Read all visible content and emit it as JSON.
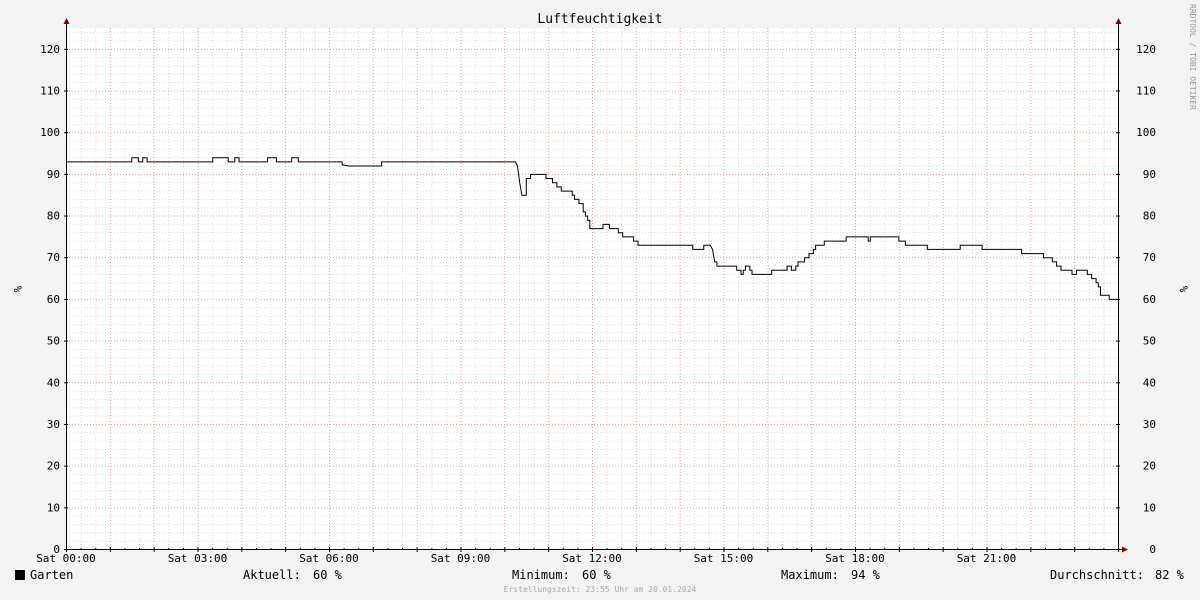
{
  "chart_data": {
    "type": "line",
    "title": "Luftfeuchtigkeit",
    "ylabel": "%",
    "ylabel_right": "%",
    "ylim": [
      0,
      125
    ],
    "yticks": [
      0,
      10,
      20,
      30,
      40,
      50,
      60,
      70,
      80,
      90,
      100,
      110,
      120
    ],
    "x_range_hours": [
      0,
      24
    ],
    "xticks": [
      {
        "hour": 0,
        "label": "Sat 00:00"
      },
      {
        "hour": 3,
        "label": "Sat 03:00"
      },
      {
        "hour": 6,
        "label": "Sat 06:00"
      },
      {
        "hour": 9,
        "label": "Sat 09:00"
      },
      {
        "hour": 12,
        "label": "Sat 12:00"
      },
      {
        "hour": 15,
        "label": "Sat 15:00"
      },
      {
        "hour": 18,
        "label": "Sat 18:00"
      },
      {
        "hour": 21,
        "label": "Sat 21:00"
      }
    ],
    "grid": true,
    "watermark": "RRDTOOL / TOBI OETIKER",
    "series": [
      {
        "name": "Garten",
        "color": "#000000",
        "points": [
          [
            0.0,
            93
          ],
          [
            1.5,
            93
          ],
          [
            1.5,
            94
          ],
          [
            1.65,
            94
          ],
          [
            1.65,
            93
          ],
          [
            1.75,
            93
          ],
          [
            1.75,
            94
          ],
          [
            1.85,
            94
          ],
          [
            1.85,
            93
          ],
          [
            3.35,
            93
          ],
          [
            3.35,
            94
          ],
          [
            3.7,
            94
          ],
          [
            3.7,
            93
          ],
          [
            3.85,
            93
          ],
          [
            3.85,
            94
          ],
          [
            3.95,
            94
          ],
          [
            3.95,
            93
          ],
          [
            4.6,
            93
          ],
          [
            4.6,
            94
          ],
          [
            4.8,
            94
          ],
          [
            4.8,
            93
          ],
          [
            5.15,
            93
          ],
          [
            5.15,
            94
          ],
          [
            5.3,
            94
          ],
          [
            5.3,
            93
          ],
          [
            6.3,
            93
          ],
          [
            6.3,
            92.3
          ],
          [
            6.45,
            92
          ],
          [
            7.2,
            92
          ],
          [
            7.2,
            93
          ],
          [
            10.25,
            93
          ],
          [
            10.3,
            92
          ],
          [
            10.35,
            88
          ],
          [
            10.4,
            85
          ],
          [
            10.5,
            85
          ],
          [
            10.5,
            89
          ],
          [
            10.6,
            89
          ],
          [
            10.6,
            90
          ],
          [
            10.95,
            90
          ],
          [
            10.95,
            89
          ],
          [
            11.1,
            89
          ],
          [
            11.1,
            88
          ],
          [
            11.2,
            88
          ],
          [
            11.2,
            87
          ],
          [
            11.3,
            87
          ],
          [
            11.3,
            86
          ],
          [
            11.55,
            86
          ],
          [
            11.55,
            85
          ],
          [
            11.6,
            85
          ],
          [
            11.6,
            84
          ],
          [
            11.7,
            84
          ],
          [
            11.7,
            83
          ],
          [
            11.8,
            83
          ],
          [
            11.8,
            81
          ],
          [
            11.85,
            81
          ],
          [
            11.85,
            80
          ],
          [
            11.9,
            80
          ],
          [
            11.9,
            79
          ],
          [
            11.95,
            79
          ],
          [
            11.95,
            77
          ],
          [
            12.25,
            77
          ],
          [
            12.25,
            78
          ],
          [
            12.4,
            78
          ],
          [
            12.4,
            77
          ],
          [
            12.6,
            77
          ],
          [
            12.6,
            76
          ],
          [
            12.7,
            76
          ],
          [
            12.7,
            75
          ],
          [
            12.95,
            75
          ],
          [
            12.95,
            74
          ],
          [
            13.05,
            74
          ],
          [
            13.05,
            73
          ],
          [
            14.3,
            73
          ],
          [
            14.3,
            72
          ],
          [
            14.55,
            72
          ],
          [
            14.55,
            73
          ],
          [
            14.7,
            73
          ],
          [
            14.75,
            72
          ],
          [
            14.8,
            69
          ],
          [
            14.85,
            69
          ],
          [
            14.85,
            68
          ],
          [
            15.3,
            68
          ],
          [
            15.3,
            67
          ],
          [
            15.4,
            67
          ],
          [
            15.4,
            66
          ],
          [
            15.45,
            66
          ],
          [
            15.45,
            67
          ],
          [
            15.5,
            67
          ],
          [
            15.5,
            68
          ],
          [
            15.6,
            68
          ],
          [
            15.6,
            67
          ],
          [
            15.65,
            67
          ],
          [
            15.65,
            66
          ],
          [
            16.1,
            66
          ],
          [
            16.1,
            67
          ],
          [
            16.45,
            67
          ],
          [
            16.45,
            68
          ],
          [
            16.55,
            68
          ],
          [
            16.55,
            67
          ],
          [
            16.65,
            67
          ],
          [
            16.65,
            68
          ],
          [
            16.7,
            68
          ],
          [
            16.7,
            69
          ],
          [
            16.85,
            69
          ],
          [
            16.85,
            70
          ],
          [
            16.95,
            70
          ],
          [
            16.95,
            71
          ],
          [
            17.05,
            71
          ],
          [
            17.05,
            72
          ],
          [
            17.1,
            72
          ],
          [
            17.1,
            73
          ],
          [
            17.3,
            73
          ],
          [
            17.3,
            74
          ],
          [
            17.8,
            74
          ],
          [
            17.8,
            75
          ],
          [
            18.3,
            75
          ],
          [
            18.3,
            74
          ],
          [
            18.35,
            74
          ],
          [
            18.35,
            75
          ],
          [
            19.0,
            75
          ],
          [
            19.0,
            74
          ],
          [
            19.15,
            74
          ],
          [
            19.15,
            73
          ],
          [
            19.65,
            73
          ],
          [
            19.65,
            72
          ],
          [
            20.4,
            72
          ],
          [
            20.4,
            73
          ],
          [
            20.9,
            73
          ],
          [
            20.9,
            72
          ],
          [
            21.8,
            72
          ],
          [
            21.8,
            71
          ],
          [
            22.3,
            71
          ],
          [
            22.3,
            70
          ],
          [
            22.5,
            70
          ],
          [
            22.5,
            69
          ],
          [
            22.6,
            69
          ],
          [
            22.6,
            68
          ],
          [
            22.7,
            68
          ],
          [
            22.7,
            67
          ],
          [
            22.95,
            67
          ],
          [
            22.95,
            66
          ],
          [
            23.05,
            66
          ],
          [
            23.05,
            67
          ],
          [
            23.3,
            67
          ],
          [
            23.3,
            66
          ],
          [
            23.4,
            66
          ],
          [
            23.4,
            65
          ],
          [
            23.5,
            65
          ],
          [
            23.5,
            64
          ],
          [
            23.55,
            64
          ],
          [
            23.55,
            63
          ],
          [
            23.6,
            63
          ],
          [
            23.6,
            61
          ],
          [
            23.8,
            61
          ],
          [
            23.8,
            60
          ],
          [
            24.0,
            60
          ]
        ]
      }
    ]
  },
  "legend": {
    "series_name": "Garten",
    "aktuell_label": "Aktuell:",
    "aktuell_value": "60 %",
    "minimum_label": "Minimum:",
    "minimum_value": "60 %",
    "maximum_label": "Maximum:",
    "maximum_value": "94 %",
    "durchschnitt_label": "Durchschnitt:",
    "durchschnitt_value": "82 %"
  },
  "footer": "Erstellungszeit: 23:55 Uhr am 20.01.2024"
}
